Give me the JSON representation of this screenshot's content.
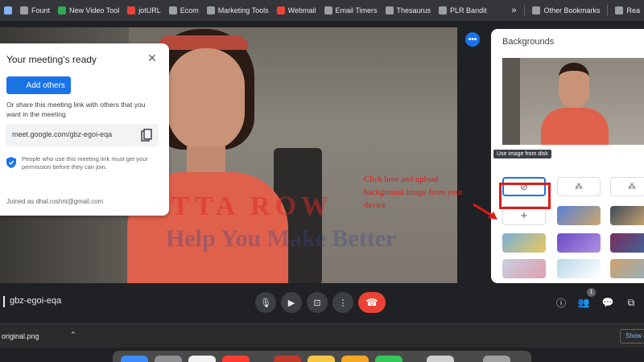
{
  "bookmarks": [
    {
      "label": "",
      "color": "#8ab4f8"
    },
    {
      "label": "Fount",
      "color": "#9aa0a6"
    },
    {
      "label": "New Video Tool",
      "color": "#34a853"
    },
    {
      "label": "jotURL",
      "color": "#ea4335"
    },
    {
      "label": "Ecom",
      "color": "#9aa0a6"
    },
    {
      "label": "Marketing Tools",
      "color": "#9aa0a6"
    },
    {
      "label": "Webmail",
      "color": "#ea4335"
    },
    {
      "label": "Email Timers",
      "color": "#9aa0a6"
    },
    {
      "label": "Thesaurus",
      "color": "#9aa0a6"
    },
    {
      "label": "PLR Bandit",
      "color": "#9aa0a6"
    }
  ],
  "bookmarks_more": "»",
  "other_bookmarks": "Other Bookmarks",
  "reading_list": "Rea",
  "meeting_card": {
    "title": "Your meeting's ready",
    "add_others": "Add others",
    "share_text": "Or share this meeting link with others that you want in the meeting",
    "link": "meet.google.com/gbz-egoi-eqa",
    "permission_text": "People who use this meeting link must get your permission before they can join.",
    "joined_as": "Joined as dhal.roshni@gmail.com"
  },
  "watermark": "HUTTA ROW",
  "watermark2": "Help You Make Better",
  "backgrounds_panel": {
    "title": "Backgrounds",
    "tooltip": "Use image from disk",
    "tiles": [
      {
        "kind": "none",
        "colors": []
      },
      {
        "kind": "blur",
        "colors": []
      },
      {
        "kind": "blur",
        "colors": []
      },
      {
        "kind": "upload",
        "colors": []
      },
      {
        "kind": "image",
        "colors": [
          "#5a7fd6",
          "#c9a86a"
        ]
      },
      {
        "kind": "image",
        "colors": [
          "#3f4b5a",
          "#d8b070"
        ]
      },
      {
        "kind": "image",
        "colors": [
          "#7bb0d8",
          "#e8c860"
        ]
      },
      {
        "kind": "image",
        "colors": [
          "#6a4cc4",
          "#b090e0"
        ]
      },
      {
        "kind": "image",
        "colors": [
          "#7a2e5c",
          "#3a6aa0"
        ]
      },
      {
        "kind": "image",
        "colors": [
          "#c6cfe0",
          "#e0a0b0"
        ]
      },
      {
        "kind": "image",
        "colors": [
          "#b8d8e8",
          "#ffffff"
        ]
      },
      {
        "kind": "image",
        "colors": [
          "#d0a070",
          "#90b0c0"
        ]
      }
    ]
  },
  "annotation": "Click here and upload background image from your device",
  "meeting_code": "gbz-egoi-eqa",
  "participant_count": "1",
  "download": {
    "filename": "original.png",
    "show_all": "Show a"
  },
  "colors": {
    "accent": "#1a73e8",
    "hangup": "#ea4335",
    "annotation": "#e01b1b"
  }
}
